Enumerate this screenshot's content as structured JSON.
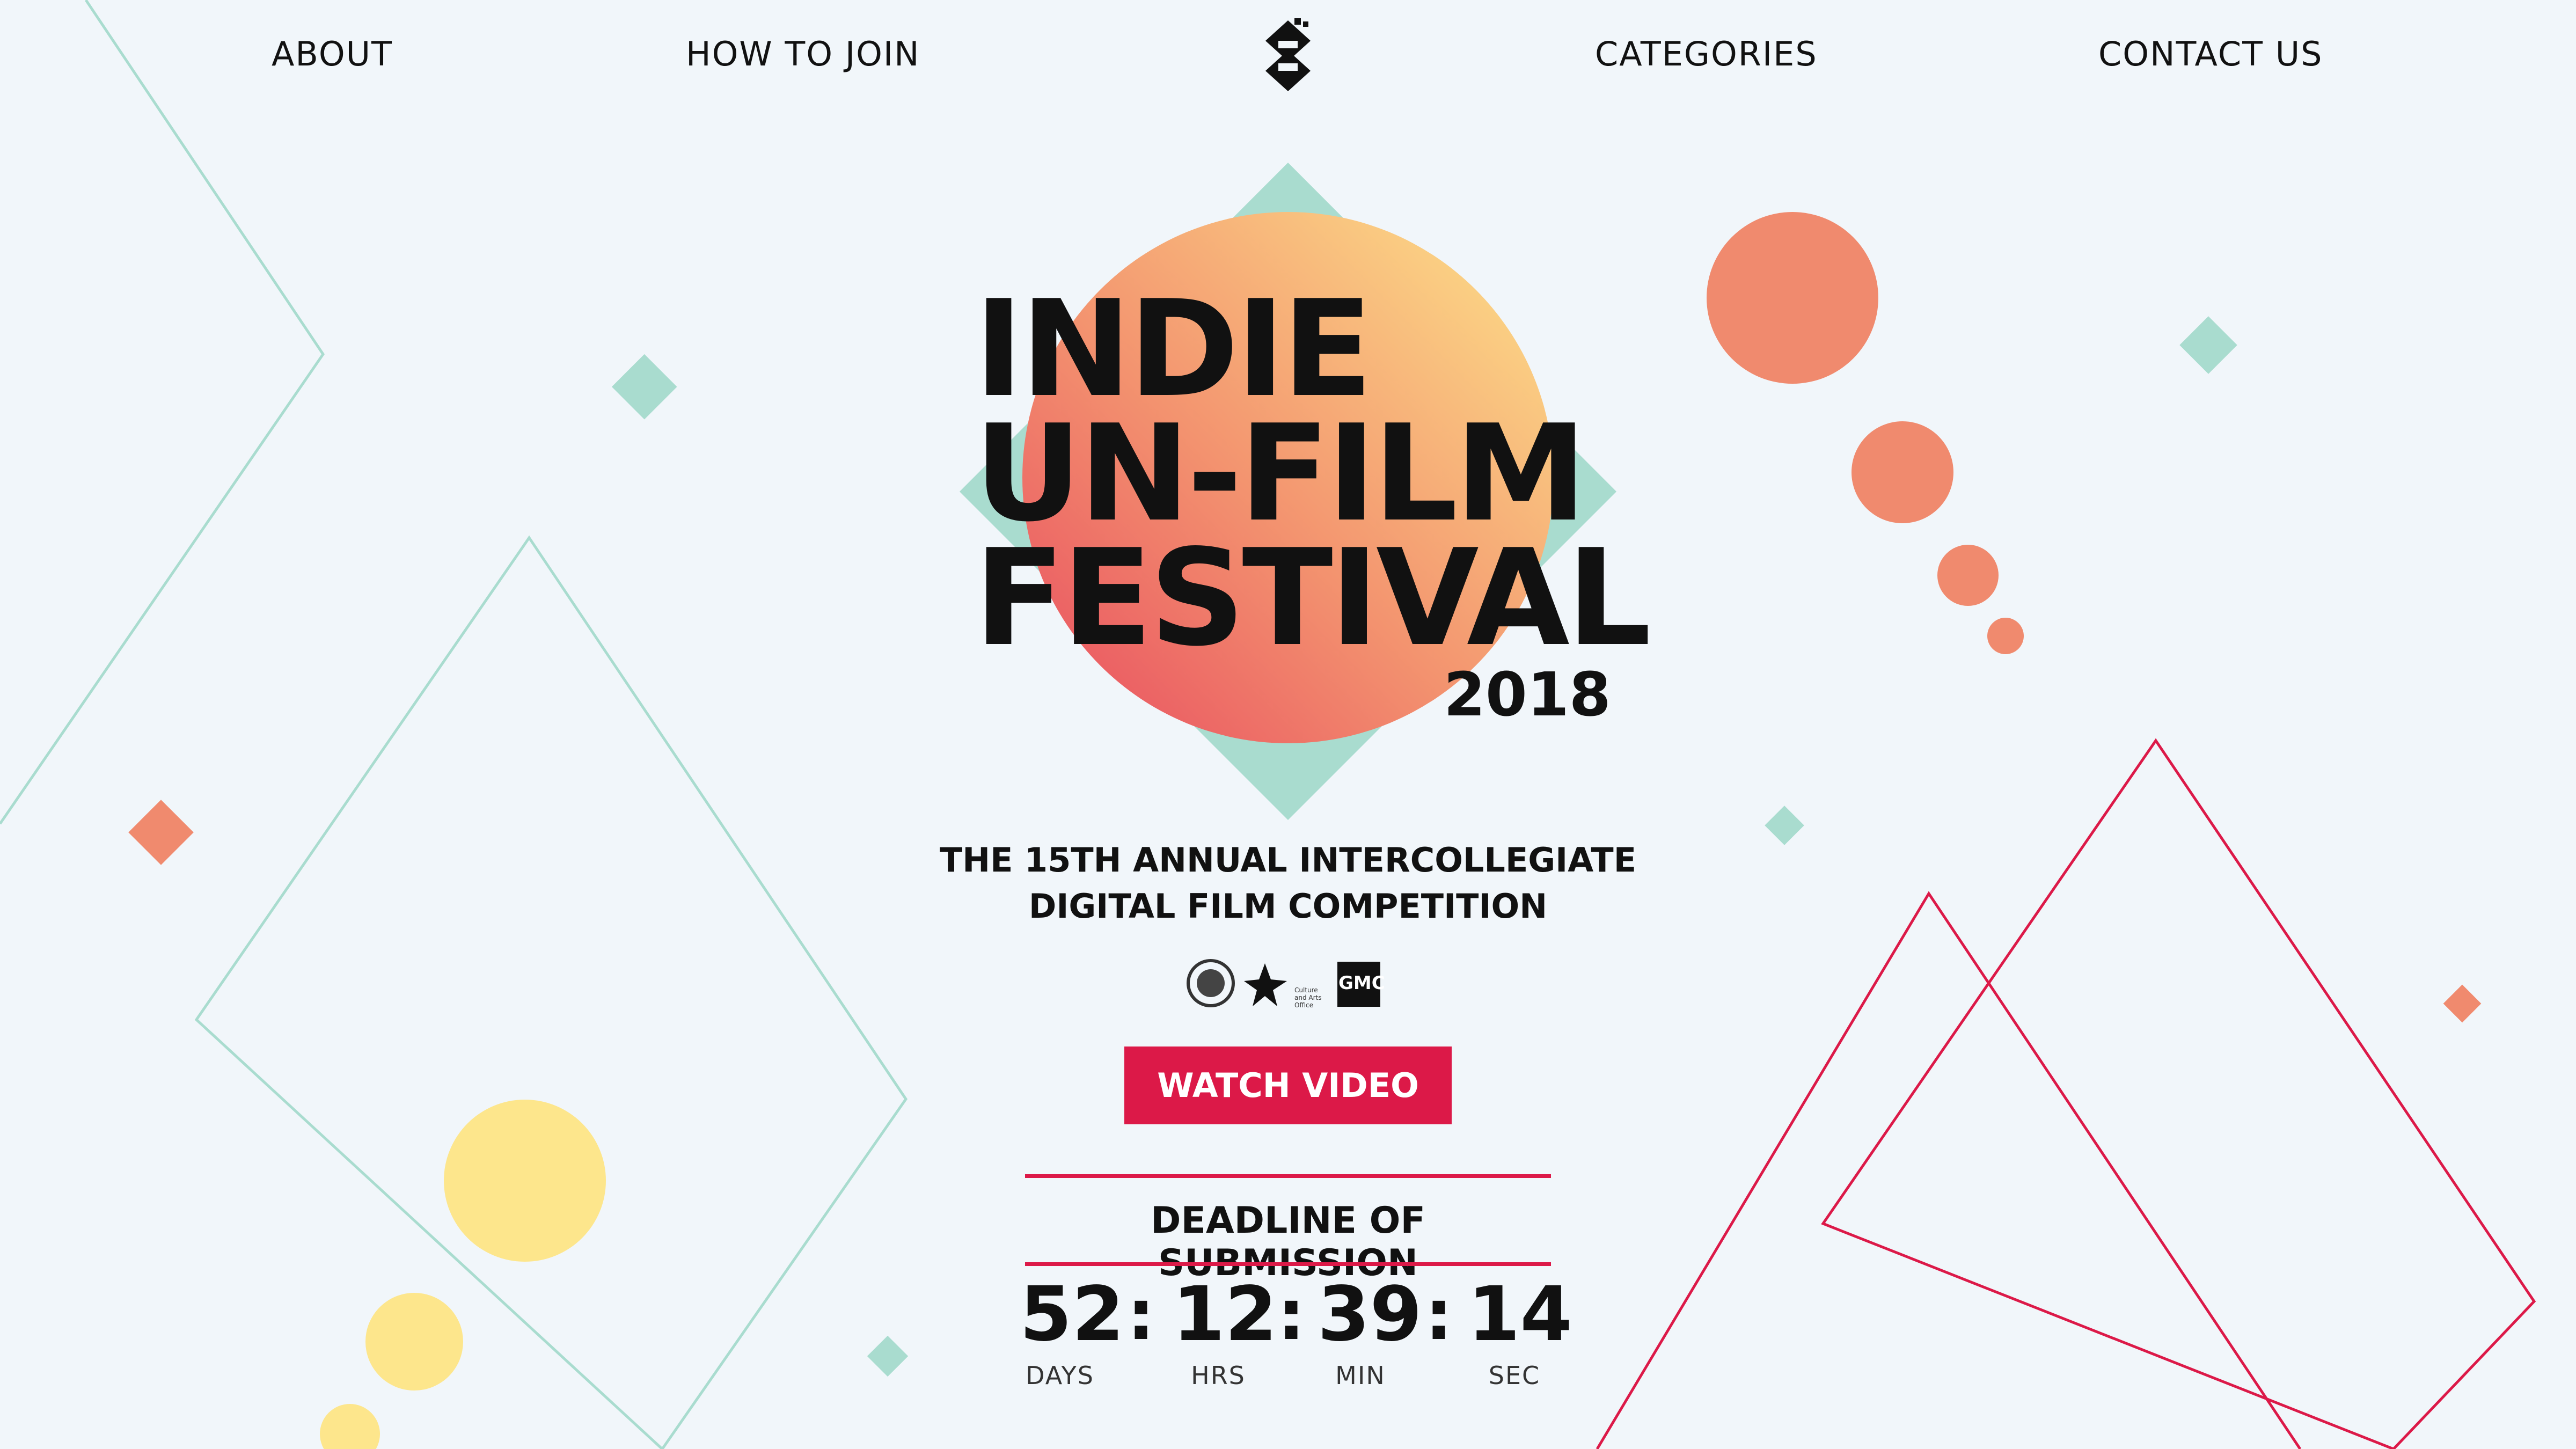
{
  "nav": {
    "about": "ABOUT",
    "how_to_join": "HOW TO JOIN",
    "categories": "CATEGORIES",
    "contact_us": "CONTACT US"
  },
  "logo_icon": "film-festival-logo-icon",
  "hero": {
    "title_lines": [
      "INDIE",
      "UN-FILM",
      "FESTIVAL"
    ],
    "year": "2018",
    "subtitle_lines": [
      "THE 15TH ANNUAL INTERCOLLEGIATE",
      "DIGITAL FILM COMPETITION"
    ]
  },
  "sponsors": {
    "logo_text": "GMC",
    "caption": "Culture and Arts Office"
  },
  "cta": {
    "watch_video": "WATCH VIDEO"
  },
  "deadline": {
    "label": "DEADLINE OF SUBMISSION",
    "separator": ":",
    "days": "52",
    "hours": "12",
    "minutes": "39",
    "seconds": "14",
    "days_label": "DAYS",
    "hours_label": "HRS",
    "minutes_label": "MIN",
    "seconds_label": "SEC"
  },
  "colors": {
    "background": "#f1f6fa",
    "accent_red": "#dc1948",
    "coral": "#f08a6e",
    "mint": "#a9dccf",
    "yellow": "#fde68c",
    "text": "#111111"
  }
}
